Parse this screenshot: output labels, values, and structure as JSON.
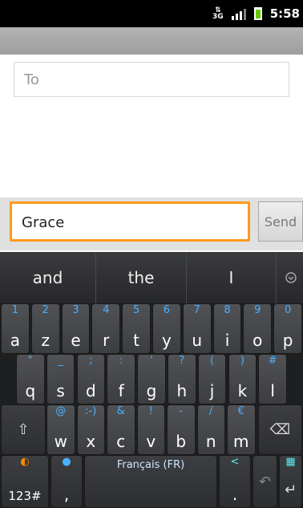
{
  "status": {
    "time": "5:58",
    "network": "3G"
  },
  "recipient": {
    "placeholder": "To"
  },
  "compose": {
    "text": "Grace",
    "send_label": "Send"
  },
  "suggestions": [
    "and",
    "the",
    "I"
  ],
  "keyboard": {
    "row1": [
      {
        "hint": "1",
        "main": "a"
      },
      {
        "hint": "2",
        "main": "z"
      },
      {
        "hint": "3",
        "main": "e"
      },
      {
        "hint": "4",
        "main": "r"
      },
      {
        "hint": "5",
        "main": "t"
      },
      {
        "hint": "6",
        "main": "y"
      },
      {
        "hint": "7",
        "main": "u"
      },
      {
        "hint": "8",
        "main": "i"
      },
      {
        "hint": "9",
        "main": "o"
      },
      {
        "hint": "0",
        "main": "p"
      }
    ],
    "row2": [
      {
        "hint": "\"",
        "main": "q"
      },
      {
        "hint": "_",
        "main": "s"
      },
      {
        "hint": ";",
        "main": "d"
      },
      {
        "hint": ":",
        "main": "f"
      },
      {
        "hint": "'",
        "main": "g"
      },
      {
        "hint": "?",
        "main": "h"
      },
      {
        "hint": "(",
        "main": "j"
      },
      {
        "hint": ")",
        "main": "k"
      },
      {
        "hint": "#",
        "main": "l"
      }
    ],
    "row3": [
      {
        "hint": "@",
        "main": "w"
      },
      {
        "hint": ":-)",
        "main": "x"
      },
      {
        "hint": "&",
        "main": "c"
      },
      {
        "hint": "!",
        "main": "v"
      },
      {
        "hint": "-",
        "main": "b"
      },
      {
        "hint": "/",
        "main": "n"
      },
      {
        "hint": "€",
        "main": "m"
      }
    ],
    "shift_icon": "⇧",
    "delete_icon": "⌫",
    "symbols_label": "123#",
    "comma": ",",
    "space_label": "Français (FR)",
    "period": ".",
    "undo_icon": "↶",
    "enter_icon": "↵"
  }
}
